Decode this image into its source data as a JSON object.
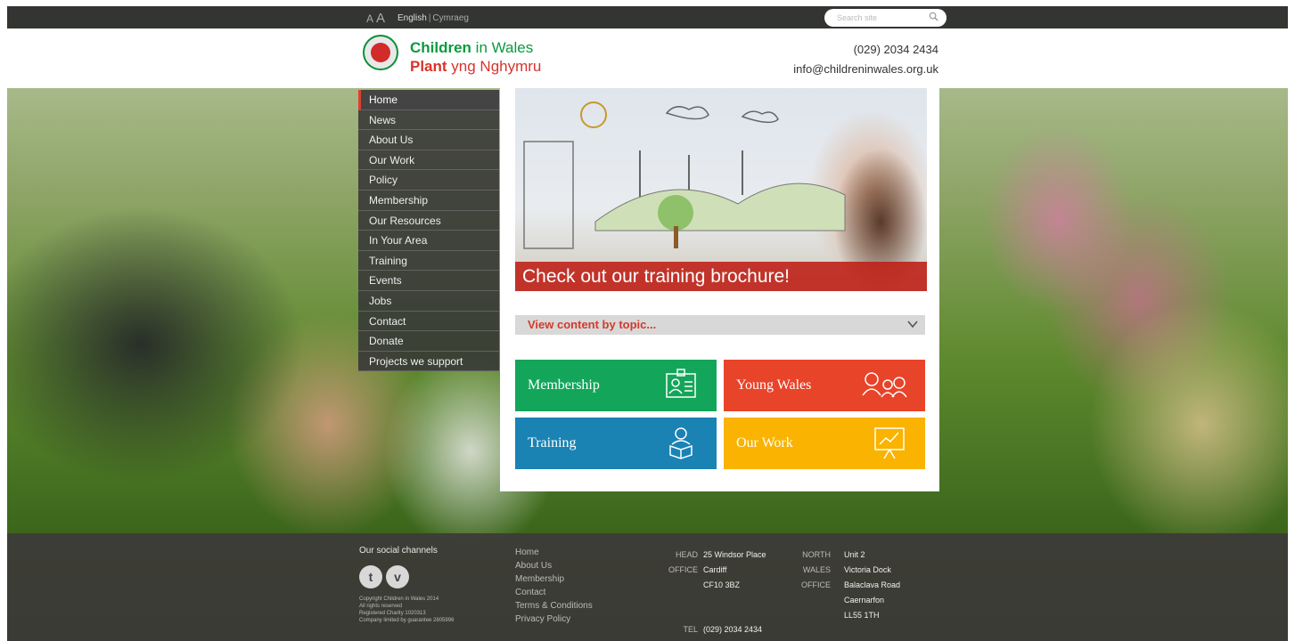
{
  "topbar": {
    "font_small": "A",
    "font_large": "A",
    "lang_current": "English",
    "lang_sep": "|",
    "lang_alt": "Cymraeg",
    "search_placeholder": "Search site"
  },
  "header": {
    "logo_line1_bold": "Children",
    "logo_line1_rest": " in Wales",
    "logo_line2_bold": "Plant",
    "logo_line2_rest": " yng Nghymru",
    "phone": "(029) 2034 2434",
    "email": "info@childreninwales.org.uk"
  },
  "nav": {
    "items": [
      {
        "label": "Home"
      },
      {
        "label": "News"
      },
      {
        "label": "About Us"
      },
      {
        "label": "Our Work"
      },
      {
        "label": "Policy"
      },
      {
        "label": "Membership"
      },
      {
        "label": "Our Resources"
      },
      {
        "label": "In Your Area"
      },
      {
        "label": "Training"
      },
      {
        "label": "Events"
      },
      {
        "label": "Jobs"
      },
      {
        "label": "Contact"
      },
      {
        "label": "Donate"
      },
      {
        "label": "Projects we support"
      }
    ]
  },
  "hero": {
    "caption": "Check out our training brochure!"
  },
  "topic_select": {
    "value": "View content by topic..."
  },
  "tiles": {
    "membership": "Membership",
    "young_wales": "Young Wales",
    "training": "Training",
    "our_work": "Our Work"
  },
  "footer": {
    "social_title": "Our social channels",
    "twitter": "t",
    "vimeo": "v",
    "copyright_1": "Copyright Children in Wales 2014",
    "copyright_2": "All rights reserved",
    "copyright_3": "Registered Charity 1020313",
    "copyright_4": "Company limited by guarantee 2805996",
    "links": [
      "Home",
      "About Us",
      "Membership",
      "Contact",
      "Terms & Conditions",
      "Privacy Policy"
    ],
    "head_office_label_1": "HEAD",
    "head_office_label_2": "OFFICE",
    "head_addr_1": "25 Windsor Place",
    "head_addr_2": "Cardiff",
    "head_addr_3": "CF10 3BZ",
    "tel_label": "TEL",
    "tel": "(029) 2034 2434",
    "north_label_1": "NORTH",
    "north_label_2": "WALES",
    "north_label_3": "OFFICE",
    "north_addr_1": "Unit 2",
    "north_addr_2": "Victoria Dock",
    "north_addr_3": "Balaclava Road",
    "north_addr_4": "Caernarfon",
    "north_addr_5": "LL55 1TH"
  },
  "colors": {
    "green": "#13a65a",
    "red": "#e8442a",
    "blue": "#1a83b4",
    "yellow": "#f9b300"
  }
}
